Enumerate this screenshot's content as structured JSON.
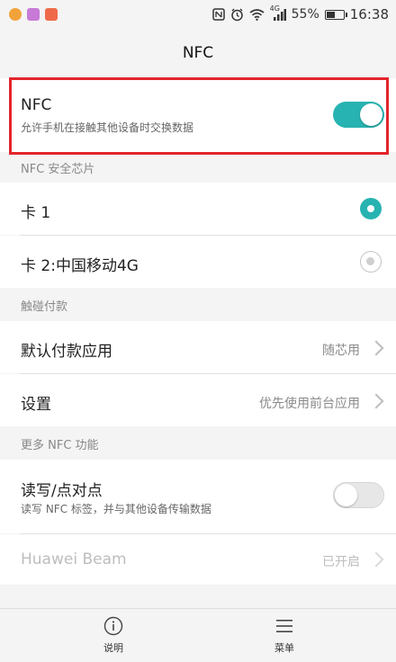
{
  "status_bar": {
    "time": "16:38",
    "battery": "55%",
    "battery_level": 0.55,
    "network": "4G",
    "app_icons": [
      "photos-app-icon",
      "gallery-app-icon",
      "video-app-icon"
    ],
    "app_icon_colors": [
      "#f2a23a",
      "#c77ad6",
      "#ef6a4a"
    ]
  },
  "header": {
    "title": "NFC"
  },
  "nfc": {
    "title": "NFC",
    "subtitle": "允许手机在接触其他设备时交换数据",
    "enabled": true
  },
  "sections": {
    "secure_element": "NFC 安全芯片",
    "payment": "触碰付款",
    "more": "更多 NFC 功能"
  },
  "secure_element": {
    "options": [
      {
        "label": "卡 1",
        "selected": true
      },
      {
        "label": "卡 2:中国移动4G",
        "selected": false
      }
    ]
  },
  "payment": {
    "default_app": {
      "label": "默认付款应用",
      "value": "随芯用"
    },
    "settings": {
      "label": "设置",
      "value": "优先使用前台应用"
    }
  },
  "more": {
    "read_write": {
      "title": "读写/点对点",
      "subtitle": "读写 NFC 标签，并与其他设备传输数据",
      "enabled": false
    },
    "beam": {
      "label": "Huawei Beam",
      "value": "已开启"
    }
  },
  "bottom_bar": {
    "help_label": "说明",
    "menu_label": "菜单"
  },
  "colors": {
    "accent": "#27b3b1",
    "highlight": "#e2252b"
  }
}
